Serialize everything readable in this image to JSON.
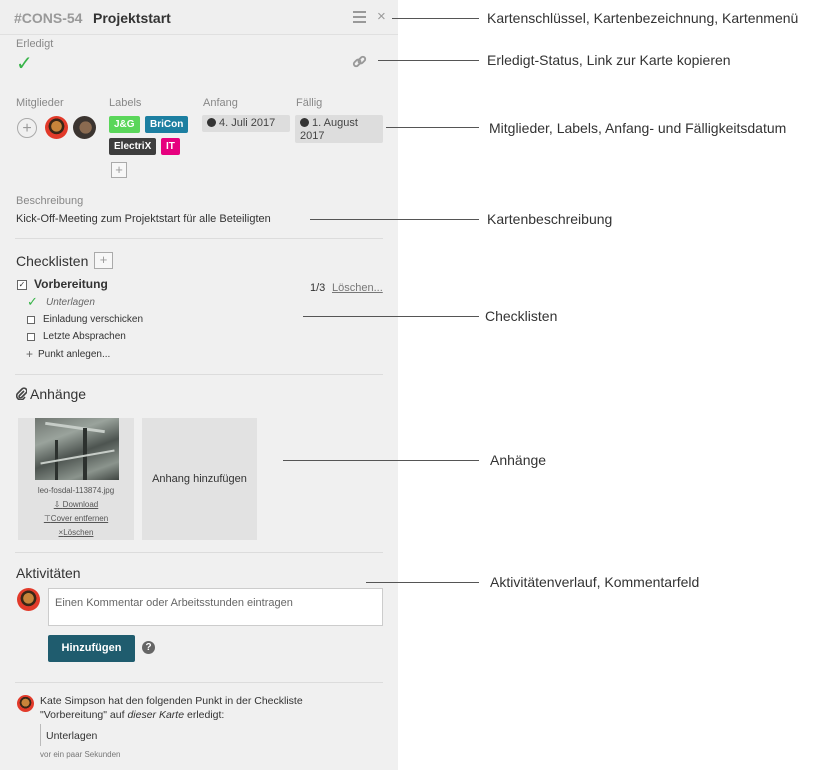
{
  "card": {
    "key": "#CONS-54",
    "title": "Projektstart",
    "menu_icon": "hamburger-icon",
    "close_icon": "close-icon"
  },
  "done": {
    "label": "Erledigt",
    "icon": "checkmark-icon",
    "link_icon": "link-icon"
  },
  "meta": {
    "members_label": "Mitglieder",
    "labels_label": "Labels",
    "start_label": "Anfang",
    "due_label": "Fällig",
    "labels": [
      {
        "text": "J&G",
        "color": "#5ad65a"
      },
      {
        "text": "BriCon",
        "color": "#1c7fa1"
      },
      {
        "text": "ElectriX",
        "color": "#3d3d3d"
      },
      {
        "text": "IT",
        "color": "#e6007e"
      }
    ],
    "start_date": "4. Juli 2017",
    "due_date_1": "1. August",
    "due_date_2": "2017"
  },
  "description": {
    "label": "Beschreibung",
    "text": "Kick-Off-Meeting zum Projektstart für alle Beteiligten"
  },
  "checklists": {
    "title": "Checklisten",
    "name": "Vorbereitung",
    "progress": "1/3",
    "delete": "Löschen...",
    "items": [
      {
        "text": "Unterlagen",
        "done": true
      },
      {
        "text": "Einladung verschicken",
        "done": false
      },
      {
        "text": "Letzte Absprachen",
        "done": false
      }
    ],
    "add_item": "Punkt anlegen..."
  },
  "attachments": {
    "title": "Anhänge",
    "file_name": "leo-fosdal-113874.jpg",
    "download": "Download",
    "remove_cover": "Cover entfernen",
    "delete": "Löschen",
    "add": "Anhang hinzufügen"
  },
  "activity": {
    "title": "Aktivitäten",
    "placeholder": "Einen Kommentar oder Arbeitsstunden eintragen",
    "submit": "Hinzufügen",
    "entry_line1": "Kate Simpson hat den folgenden Punkt in der Checkliste",
    "entry_line2_a": "\"Vorbereitung\" auf ",
    "entry_line2_b": "dieser Karte",
    "entry_line2_c": " erledigt:",
    "entry_item": "Unterlagen",
    "entry_time": "vor ein paar Sekunden"
  },
  "annotations": [
    "Kartenschlüssel, Kartenbezeichnung, Kartenmenü",
    "Erledigt-Status, Link zur Karte kopieren",
    "Mitglieder, Labels, Anfang- und Fälligkeitsdatum",
    "Kartenbeschreibung",
    "Checklisten",
    "Anhänge",
    "Aktivitätenverlauf, Kommentarfeld"
  ]
}
